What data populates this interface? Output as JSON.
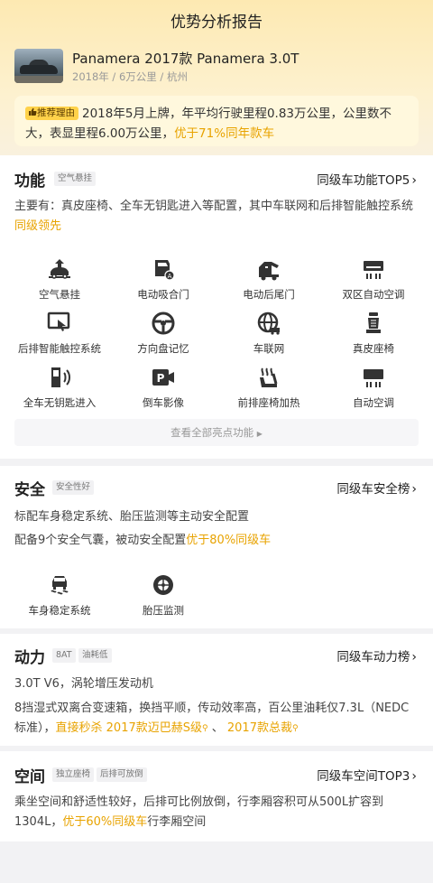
{
  "header": {
    "title": "优势分析报告"
  },
  "car": {
    "name": "Panamera 2017款 Panamera 3.0T",
    "meta": "2018年 / 6万公里 / 杭州"
  },
  "reason": {
    "tag": "推荐理由",
    "text": "2018年5月上牌，年平均行驶里程0.83万公里，公里数不大，表显里程6.00万公里，",
    "highlight": "优于71%同年款车"
  },
  "features": {
    "title": "功能",
    "tag": "空气悬挂",
    "rank_link": "同级车功能TOP5",
    "summary": "主要有：真皮座椅、全车无钥匙进入等配置，其中车联网和后排智能触控系统",
    "summary_highlight": "同级领先",
    "items": [
      {
        "label": "空气悬挂",
        "icon": "air-suspension-icon"
      },
      {
        "label": "电动吸合门",
        "icon": "soft-close-door-icon"
      },
      {
        "label": "电动后尾门",
        "icon": "power-tailgate-icon"
      },
      {
        "label": "双区自动空调",
        "icon": "dual-zone-ac-icon"
      },
      {
        "label": "后排智能触控系统",
        "icon": "rear-touch-control-icon"
      },
      {
        "label": "方向盘记忆",
        "icon": "steering-memory-icon"
      },
      {
        "label": "车联网",
        "icon": "connected-car-icon"
      },
      {
        "label": "真皮座椅",
        "icon": "leather-seat-icon"
      },
      {
        "label": "全车无钥匙进入",
        "icon": "keyless-entry-icon"
      },
      {
        "label": "倒车影像",
        "icon": "parking-camera-icon"
      },
      {
        "label": "前排座椅加热",
        "icon": "seat-heating-icon"
      },
      {
        "label": "自动空调",
        "icon": "auto-ac-icon"
      }
    ],
    "view_all": "查看全部亮点功能"
  },
  "safety": {
    "title": "安全",
    "tag": "安全性好",
    "rank_link": "同级车安全榜",
    "line1": "标配车身稳定系统、胎压监测等主动安全配置",
    "line2": "配备9个安全气囊，被动安全配置",
    "line2_highlight": "优于80%同级车",
    "items": [
      {
        "label": "车身稳定系统",
        "icon": "stability-control-icon"
      },
      {
        "label": "胎压监测",
        "icon": "tire-pressure-icon"
      }
    ]
  },
  "power": {
    "title": "动力",
    "tags": [
      "8AT",
      "油耗低"
    ],
    "rank_link": "同级车动力榜",
    "line1": "3.0T V6，涡轮增压发动机",
    "line2": "8挡湿式双离合变速箱，换挡平顺，传动效率高，百公里油耗仅7.3L（NEDC标准），",
    "line2_highlight": "直接秒杀 2017款迈巴赫S级",
    "separator": "、",
    "line2_highlight2": "2017款总裁"
  },
  "space": {
    "title": "空间",
    "tags": [
      "独立座椅",
      "后排可放倒"
    ],
    "rank_link": "同级车空间TOP3",
    "text": "乘坐空间和舒适性较好，后排可比例放倒，行李厢容积可从500L扩容到1304L，",
    "highlight": "优于60%同级车",
    "text_tail": "行李厢空间"
  },
  "colors": {
    "accent": "#e8a300",
    "tag_bg": "#ffd24a",
    "page_bg": "#f2f2f4"
  }
}
